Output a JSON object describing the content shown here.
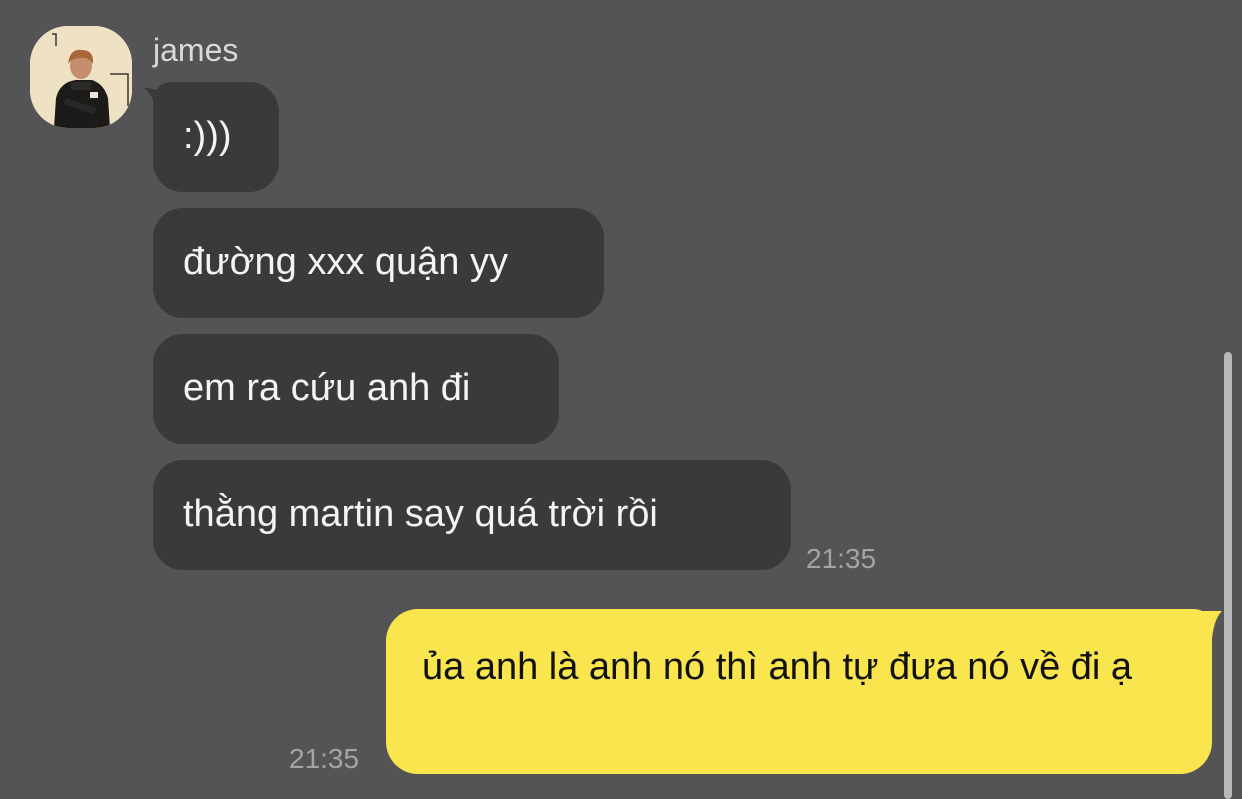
{
  "chat": {
    "contact": {
      "name": "james",
      "avatar_icon": "profile-photo"
    },
    "messages": [
      {
        "direction": "incoming",
        "text": ":)))"
      },
      {
        "direction": "incoming",
        "text": "đường xxx quận yy"
      },
      {
        "direction": "incoming",
        "text": "em ra cứu anh đi"
      },
      {
        "direction": "incoming",
        "text": "thằng martin say quá trời rồi",
        "time": "21:35"
      },
      {
        "direction": "outgoing",
        "text": "ủa anh là anh nó thì anh tự đưa nó về đi ạ",
        "time": "21:35"
      }
    ]
  },
  "colors": {
    "background": "#545355",
    "incoming_bubble": "#3a393c",
    "outgoing_bubble": "#f9e54e",
    "timestamp": "#a4a3a6"
  }
}
